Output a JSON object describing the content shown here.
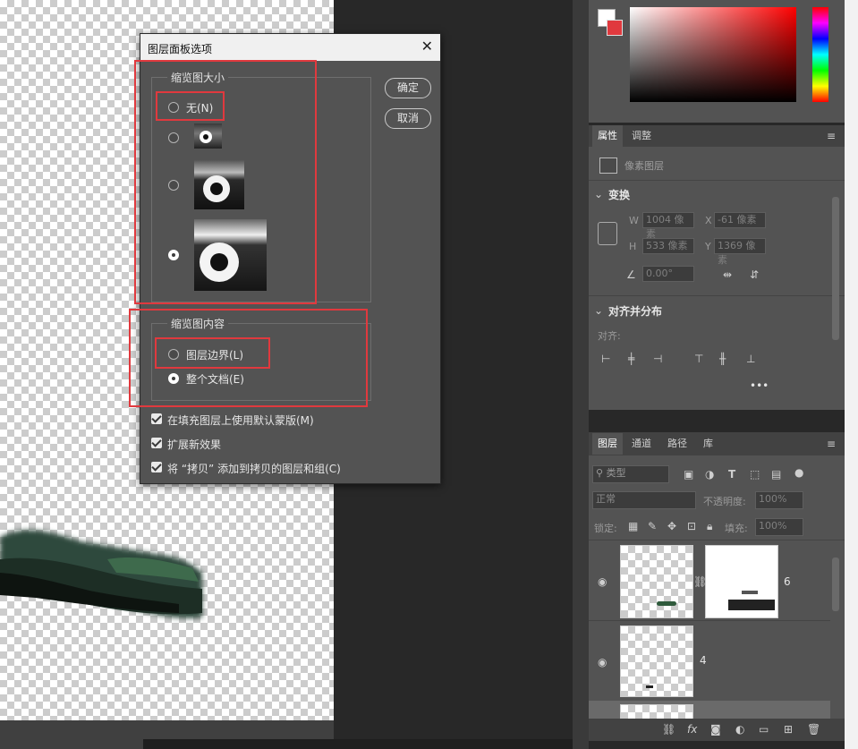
{
  "dialog": {
    "title": "图层面板选项",
    "close": "✕",
    "ok_label": "确定",
    "cancel_label": "取消",
    "thumb_size": {
      "legend": "缩览图大小",
      "none_label": "无(N)"
    },
    "thumb_content": {
      "legend": "缩览图内容",
      "layer_bounds_label": "图层边界(L)",
      "entire_doc_label": "整个文档(E)"
    },
    "options": [
      "在填充图层上使用默认蒙版(M)",
      "扩展新效果",
      "将 “拷贝” 添加到拷贝的图层和组(C)"
    ]
  },
  "properties": {
    "tabs": [
      "属性",
      "调整"
    ],
    "pixel_layer": "像素图层",
    "transform_title": "变换",
    "w_label": "W",
    "w_value": "1004 像素",
    "x_label": "X",
    "x_value": "-61 像素",
    "h_label": "H",
    "h_value": "533 像素",
    "y_label": "Y",
    "y_value": "1369 像素",
    "angle_value": "0.00°",
    "align_title": "对齐并分布",
    "align_label": "对齐:",
    "more": "•••"
  },
  "layers": {
    "tabs": [
      "图层",
      "通道",
      "路径",
      "库"
    ],
    "filter_kind": "类型",
    "blend_mode": "正常",
    "opacity_label": "不透明度:",
    "opacity_value": "100%",
    "lock_label": "锁定:",
    "fill_label": "填充:",
    "fill_value": "100%",
    "rows": [
      {
        "name": "6"
      },
      {
        "name": "4"
      }
    ]
  },
  "colors": {
    "accent_red": "#e0393e",
    "panel": "#535353",
    "canvas_bg": "#282828"
  }
}
